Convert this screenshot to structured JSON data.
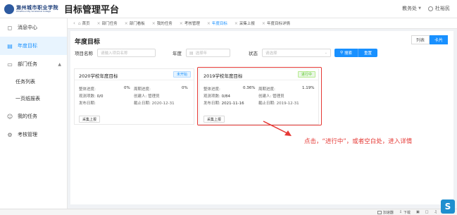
{
  "header": {
    "logo_cn": "滁州城市职业学院",
    "logo_en": "ChuZhou City Vocational College",
    "app_title": "目标管理平台",
    "user_name": "杜裕民",
    "dept_label": "教务处"
  },
  "sidebar": {
    "items": [
      {
        "label": "消息中心",
        "icon": "bell-icon"
      },
      {
        "label": "年度目标",
        "icon": "calendar-icon"
      },
      {
        "label": "部门任务",
        "icon": "folder-icon"
      },
      {
        "label": "任务列表"
      },
      {
        "label": "一页纸报表"
      },
      {
        "label": "我的任务",
        "icon": "user-icon"
      },
      {
        "label": "考核管理",
        "icon": "gear-icon"
      }
    ]
  },
  "tabs": [
    {
      "label": "首页"
    },
    {
      "label": "部门任务"
    },
    {
      "label": "部门看板"
    },
    {
      "label": "我的任务"
    },
    {
      "label": "考核管理"
    },
    {
      "label": "年度目标"
    },
    {
      "label": "采集上报"
    },
    {
      "label": "年度目标详情"
    }
  ],
  "main": {
    "title": "年度目标",
    "view_list": "列表",
    "view_card": "卡片",
    "filters": {
      "name_label": "项目名称",
      "name_placeholder": "请输入项目名称",
      "year_label": "年度",
      "year_placeholder": "选择年",
      "status_label": "状态",
      "status_placeholder": "请选择",
      "search_btn": "搜索",
      "reset_btn": "重置"
    },
    "cards": [
      {
        "title": "2020学校年度目标",
        "status": "未开始",
        "overall_label": "整体进度:",
        "overall_value": "0%",
        "period_label": "周期进度:",
        "period_value": "0%",
        "count_label": "观测项数:",
        "count_value": "0/0",
        "creator_label": "创建人:",
        "creator_value": "管理员",
        "publish_label": "发布日期:",
        "publish_value": "",
        "deadline_label": "截止日期:",
        "deadline_value": "2020-12-31",
        "btn": "采集上报"
      },
      {
        "title": "2019学校年度目标",
        "status": "进行中",
        "overall_label": "整体进度:",
        "overall_value": "0.36%",
        "period_label": "周期进度:",
        "period_value": "1.19%",
        "count_label": "观测项数:",
        "count_value": "0/84",
        "creator_label": "创建人:",
        "creator_value": "管理员",
        "publish_label": "发布日期:",
        "publish_value": "2021-11-16",
        "deadline_label": "截止日期:",
        "deadline_value": "2019-12-31",
        "btn": "采集上报"
      }
    ],
    "annotation": "点击，“进行中”，或者空白处，进入详情"
  },
  "taskbar": {
    "speed": "加速器",
    "download": "下载",
    "colors": {
      "accent": "#1890ff",
      "annotation": "#e53935",
      "ongoing": "#52c41a"
    }
  }
}
